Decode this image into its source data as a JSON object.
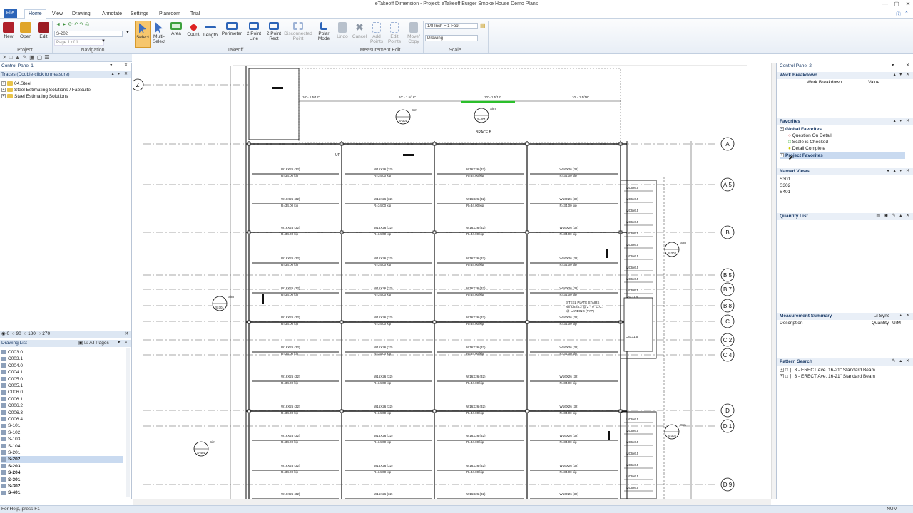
{
  "window": {
    "title": "eTakeoff Dimension - Project: eTakeoff Burger Smoke House Demo Plans"
  },
  "menu": {
    "file": "File",
    "tabs": [
      "Home",
      "View",
      "Drawing",
      "Annotate",
      "Settings",
      "Planroom",
      "Trial"
    ]
  },
  "ribbon": {
    "project": {
      "new": "New",
      "open": "Open",
      "edit": "Edit",
      "group": "Project"
    },
    "navigation": {
      "page_value": "S-202",
      "page_of": "Page 1 of 1",
      "group": "Navigation"
    },
    "takeoff": {
      "select": "Select",
      "multi_select": "Multi-\nSelect",
      "area": "Area",
      "count": "Count",
      "length": "Length",
      "perimeter": "Perimeter",
      "two_point_line": "2 Point\nLine",
      "two_point_rect": "2 Point\nRect",
      "disconnected_point": "Disconnected\nPoint",
      "polar_mode": "Polar\nMode",
      "group": "Takeoff"
    },
    "measurement_edit": {
      "undo": "Undo",
      "cancel": "Cancel",
      "add_points": "Add\nPoints",
      "edit_points": "Edit\nPoints",
      "move_copy": "Move/\nCopy",
      "group": "Measurement Edit"
    },
    "scale": {
      "scale_value": "1/8 Inch = 1 Foot",
      "scale_name": "Drawing",
      "group": "Scale"
    }
  },
  "left_panel": {
    "title": "Control Panel 1",
    "traces_title": "Traces (Double-click to measure)",
    "traces": [
      "04.Steel",
      "Steel Estimating Solutions / FabSuite",
      "Steel Estimating Solutions"
    ],
    "rotation": [
      "0",
      "90",
      "180",
      "270"
    ],
    "drawing_list_title": "Drawing List",
    "all_pages": "All Pages",
    "drawings": [
      "C003.0",
      "C003.1",
      "C004.0",
      "C004.1",
      "C005.0",
      "C005.1",
      "C006.0",
      "C006.1",
      "C006.2",
      "C006.3",
      "C006.4",
      "S-101",
      "S-102",
      "S-103",
      "S-104",
      "S-201",
      "S-202",
      "S-203",
      "S-204",
      "S-301",
      "S-302",
      "S-401"
    ],
    "bold_from": 16,
    "selected": "S-202"
  },
  "right_panel": {
    "title": "Control Panel 2",
    "work_breakdown": {
      "title": "Work Breakdown",
      "col1": "Work Breakdown",
      "col2": "Value"
    },
    "favorites": {
      "title": "Favorites",
      "global": "Global Favorites",
      "items": [
        "Question On Detail",
        "Scale is Checked",
        "Detail Complete"
      ],
      "project": "Project Favorites"
    },
    "named_views": {
      "title": "Named Views",
      "items": [
        "S301",
        "S302",
        "S401"
      ]
    },
    "quantity_list": {
      "title": "Quantity List"
    },
    "measurement_summary": {
      "title": "Measurement Summary",
      "sync": "Sync",
      "col1": "Description",
      "col2": "Quantity",
      "col3": "U/M"
    },
    "pattern_search": {
      "title": "Pattern Search",
      "items": [
        "3 - ERECT Ave. 16-21\" Standard Beam",
        "3 - ERECT Ave. 16-21\" Standard Beam"
      ]
    }
  },
  "drawing": {
    "grid_right": [
      "A",
      "A.5",
      "B",
      "B.5",
      "B.7",
      "B.8",
      "C",
      "C.2",
      "C.4",
      "D",
      "D.1",
      "D.9"
    ],
    "grid_left": "Z",
    "beam_label": "W16X26",
    "beam_count": "(32)",
    "reaction": "R=34.00 kip",
    "dim_top": "10' - 1 5/16\"",
    "tags": [
      "S-301",
      "S-401",
      "S-301",
      "S-401",
      "S-302",
      "S-302"
    ],
    "sim": "Sim",
    "brace": "BRACE B",
    "stairs_note": "STEEL PLATE STAIRS\nW/ C8X8.2 @ 2' - 0\" O.C.\n@ LANDING (TYP)",
    "up": "UP",
    "channel": "MC6x6.5",
    "c8": "C8X11.5"
  },
  "status": {
    "left": "For Help, press F1",
    "right": "NUM"
  }
}
